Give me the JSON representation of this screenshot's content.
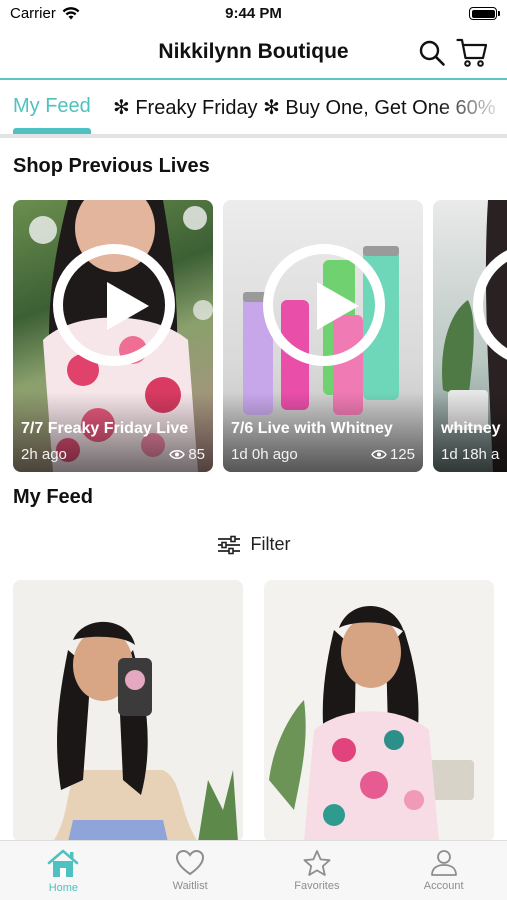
{
  "status_bar": {
    "carrier": "Carrier",
    "time": "9:44 PM"
  },
  "header": {
    "title": "Nikkilynn Boutique"
  },
  "tabs": [
    {
      "label": "My Feed",
      "active": true
    },
    {
      "label": "✻ Freaky Friday ✻ Buy One, Get One 60%"
    }
  ],
  "sections": {
    "previous_lives": "Shop Previous Lives",
    "my_feed": "My Feed"
  },
  "lives": [
    {
      "title": "7/7 Freaky Friday Live",
      "time": "2h ago",
      "views": "85"
    },
    {
      "title": "7/6 Live with Whitney",
      "time": "1d 0h ago",
      "views": "125"
    },
    {
      "title": "whitney",
      "time": "1d 18h a",
      "views": ""
    }
  ],
  "filter": {
    "label": "Filter"
  },
  "nav": [
    {
      "label": "Home",
      "icon": "home-icon",
      "active": true
    },
    {
      "label": "Waitlist",
      "icon": "heart-icon"
    },
    {
      "label": "Favorites",
      "icon": "star-icon"
    },
    {
      "label": "Account",
      "icon": "person-icon"
    }
  ],
  "colors": {
    "accent": "#4fc1c1",
    "header_rule": "#5bc6c6",
    "inactive_nav": "#8e8e8e"
  }
}
